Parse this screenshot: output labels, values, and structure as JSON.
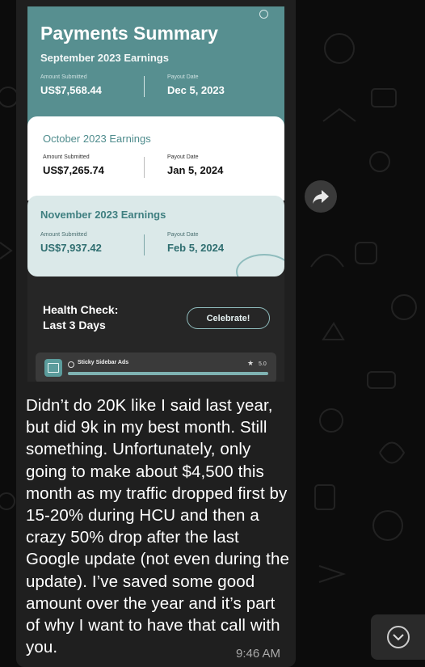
{
  "screenshot": {
    "title": "Payments Summary",
    "september": {
      "heading": "September 2023 Earnings",
      "amount_label": "Amount Submitted",
      "amount": "US$7,568.44",
      "payout_label": "Payout Date",
      "payout": "Dec 5, 2023"
    },
    "october": {
      "heading": "October 2023 Earnings",
      "amount_label": "Amount Submitted",
      "amount": "US$7,265.74",
      "payout_label": "Payout Date",
      "payout": "Jan 5, 2024"
    },
    "november": {
      "heading": "November 2023 Earnings",
      "amount_label": "Amount Submitted",
      "amount": "US$7,937.42",
      "payout_label": "Payout Date",
      "payout": "Feb 5, 2024"
    },
    "health_check": {
      "line1": "Health Check:",
      "line2": "Last 3 Days"
    },
    "celebrate_label": "Celebrate!",
    "sticky": {
      "name": "Sticky Sidebar Ads",
      "rating": "5.0"
    }
  },
  "message": {
    "text": "Didn’t do 20K like I said last year, but did 9k in my best month. Still something. Unfortunately, only going to make about $4,500 this month as my traffic dropped first by 15-20% during HCU and then a crazy 50% drop after the last Google update (not even during the update). I’ve saved some good amount over the year and it’s part of why I want to have that call with you.",
    "time": "9:46 AM"
  },
  "icons": {
    "forward": "forward-arrow-icon",
    "scroll_down": "chevron-down-icon"
  },
  "colors": {
    "teal": "#578f90",
    "bubble": "#1f1f1f",
    "background": "#0c0c0c"
  }
}
